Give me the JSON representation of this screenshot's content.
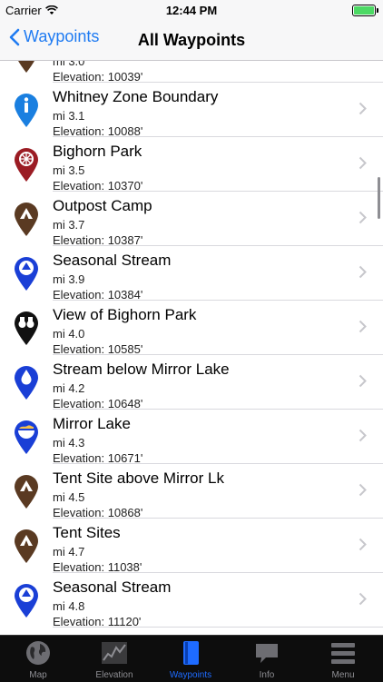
{
  "status": {
    "carrier": "Carrier",
    "time": "12:44 PM"
  },
  "nav": {
    "back_label": "Waypoints",
    "title": "All Waypoints"
  },
  "waypoints": [
    {
      "name": "",
      "mile": "mi 3.0",
      "elevation": "Elevation: 10039'",
      "icon": "camp-pin-icon",
      "color": "#5a3a22"
    },
    {
      "name": "Whitney Zone Boundary",
      "mile": "mi 3.1",
      "elevation": "Elevation: 10088'",
      "icon": "info-pin-icon",
      "color": "#1a7fe0"
    },
    {
      "name": "Bighorn Park",
      "mile": "mi 3.5",
      "elevation": "Elevation: 10370'",
      "icon": "point-of-interest-pin-icon",
      "color": "#9b1c24"
    },
    {
      "name": "Outpost Camp",
      "mile": "mi 3.7",
      "elevation": "Elevation: 10387'",
      "icon": "camp-pin-icon",
      "color": "#5a3a22"
    },
    {
      "name": "Seasonal Stream",
      "mile": "mi 3.9",
      "elevation": "Elevation: 10384'",
      "icon": "stream-pin-icon",
      "color": "#1a3fd6"
    },
    {
      "name": "View of Bighorn Park",
      "mile": "mi 4.0",
      "elevation": "Elevation: 10585'",
      "icon": "binoculars-pin-icon",
      "color": "#111111"
    },
    {
      "name": "Stream below Mirror Lake",
      "mile": "mi 4.2",
      "elevation": "Elevation: 10648'",
      "icon": "water-drop-pin-icon",
      "color": "#1a3fd6"
    },
    {
      "name": "Mirror Lake",
      "mile": "mi 4.3",
      "elevation": "Elevation: 10671'",
      "icon": "lake-pin-icon",
      "color": "#1a3fd6"
    },
    {
      "name": "Tent Site above Mirror Lk",
      "mile": "mi 4.5",
      "elevation": "Elevation: 10868'",
      "icon": "camp-pin-icon",
      "color": "#5a3a22"
    },
    {
      "name": "Tent Sites",
      "mile": "mi 4.7",
      "elevation": "Elevation: 11038'",
      "icon": "camp-pin-icon",
      "color": "#5a3a22"
    },
    {
      "name": "Seasonal Stream",
      "mile": "mi 4.8",
      "elevation": "Elevation: 11120'",
      "icon": "stream-pin-icon",
      "color": "#1a3fd6"
    }
  ],
  "tabs": [
    {
      "label": "Map",
      "icon": "globe-icon"
    },
    {
      "label": "Elevation",
      "icon": "elevation-chart-icon"
    },
    {
      "label": "Waypoints",
      "icon": "book-icon",
      "active": true
    },
    {
      "label": "Info",
      "icon": "speech-bubble-icon"
    },
    {
      "label": "Menu",
      "icon": "hamburger-menu-icon"
    }
  ],
  "colors": {
    "accent": "#1f7bf2",
    "tab_active": "#1e6bff",
    "tab_bar": "#0d0d0d"
  }
}
